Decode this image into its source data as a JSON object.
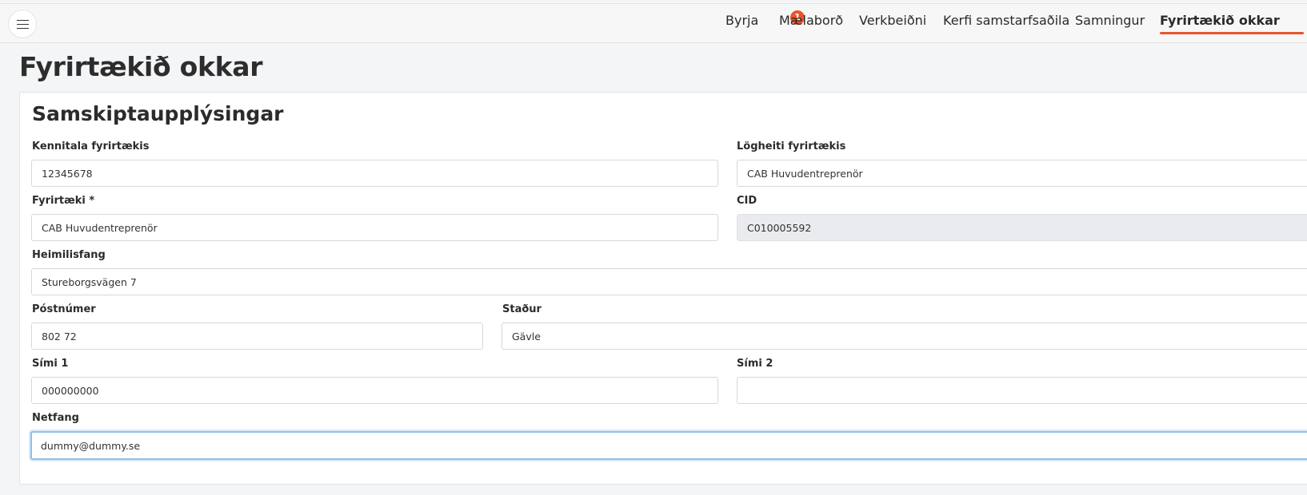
{
  "nav": {
    "items": [
      {
        "label": "Byrja"
      },
      {
        "label": "Mælaborð"
      },
      {
        "label": "Verkbeiðni"
      },
      {
        "label": "Kerfi samstarfsaðila"
      },
      {
        "label": "Samningur"
      },
      {
        "label": "Fyrirtækið okkar"
      }
    ],
    "badge": "1",
    "active": "Fyrirtækið okkar",
    "accent_color": "#e8552a"
  },
  "page": {
    "title": "Fyrirtækið okkar"
  },
  "section": {
    "title": "Samskiptaupplýsingar",
    "fields": {
      "company_id": {
        "label": "Kennitala fyrirtækis",
        "value": "12345678"
      },
      "legal_name": {
        "label": "Lögheiti fyrirtækis",
        "value": "CAB Huvudentreprenör"
      },
      "company": {
        "label": "Fyrirtæki *",
        "value": "CAB Huvudentreprenör"
      },
      "cid": {
        "label": "CID",
        "value": "C010005592"
      },
      "address": {
        "label": "Heimilisfang",
        "value": "Stureborgsvägen 7"
      },
      "postal_code": {
        "label": "Póstnúmer",
        "value": "802 72"
      },
      "city": {
        "label": "Staður",
        "value": "Gävle"
      },
      "phone1": {
        "label": "Sími 1",
        "value": "000000000"
      },
      "phone2": {
        "label": "Sími 2",
        "value": ""
      },
      "email": {
        "label": "Netfang",
        "value": "dummy@dummy.se"
      }
    }
  },
  "icons": {
    "menu": "hamburger-menu-icon"
  }
}
